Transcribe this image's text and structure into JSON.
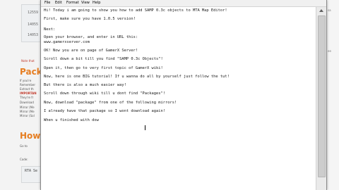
{
  "background": {
    "code_lines": [
      "12559",
      "14055",
      "14053"
    ],
    "note": "Note that",
    "heading1": "Packa",
    "body_lines": [
      "If you're",
      "Remember",
      "Extract th",
      "IMPORTAN",
      "They're fr",
      "Download",
      "Mirror (Me",
      "Mirror (Me",
      "Mirror (Sol"
    ],
    "heading2": "How t",
    "small": "Go to",
    "code_label": "Code:",
    "code2": "RTA Se",
    "right_labels": [
      "sa",
      "ee"
    ]
  },
  "notepad": {
    "menu": [
      "File",
      "Edit",
      "Format",
      "View",
      "Help"
    ],
    "lines": [
      "Hi! Today i am going to show you how to add SAMP 0.3c objects to MTA Map Editor!",
      "First, make sure you have 1.0.5 version!",
      "Next:",
      "Open your browser, and enter in URL this:",
      "www.gamerxserver.com",
      "OK! Now you are on page of GamerX Server!",
      "Scroll down a bit till you find \"SAMP 0.3c Objects\"!",
      "Open it, then go to very first topic of GamerX wiki!",
      "Now, here is one BIG tutorial! If u wanna do all by yourself just follow the tut!",
      "But there is also a much easier way!",
      "Scroll down through wiki till u dont find \"Packages\"!",
      "Now, download \"package\" from one of the following mirrors!",
      "I already have that package so I wont download again!",
      "When u finished with dow"
    ]
  }
}
